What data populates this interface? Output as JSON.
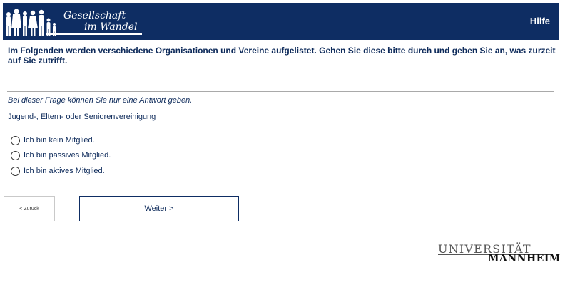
{
  "header": {
    "logo_line1": "Gesellschaft",
    "logo_line2": "im Wandel",
    "help_label": "Hilfe"
  },
  "question": {
    "intro": "Im Folgenden werden verschiedene Organisationen und Vereine aufgelistet. Gehen Sie diese bitte durch und geben Sie an, was zurzeit auf Sie zutrifft.",
    "hint": "Bei dieser Frage können Sie nur eine Antwort geben.",
    "item": "Jugend-, Eltern- oder Seniorenvereinigung",
    "options": [
      {
        "label": "Ich bin kein Mitglied.",
        "selected": false
      },
      {
        "label": "Ich bin passives Mitglied.",
        "selected": false
      },
      {
        "label": "Ich bin aktives Mitglied.",
        "selected": false
      }
    ]
  },
  "navigation": {
    "back_label": "< Zurück",
    "next_label": "Weiter >"
  },
  "footer": {
    "uni_line1": "UNIVERSITÄT",
    "uni_line2": "MANNHEIM"
  },
  "colors": {
    "header_bg": "#0e2d63",
    "text": "#0d2a5a"
  }
}
